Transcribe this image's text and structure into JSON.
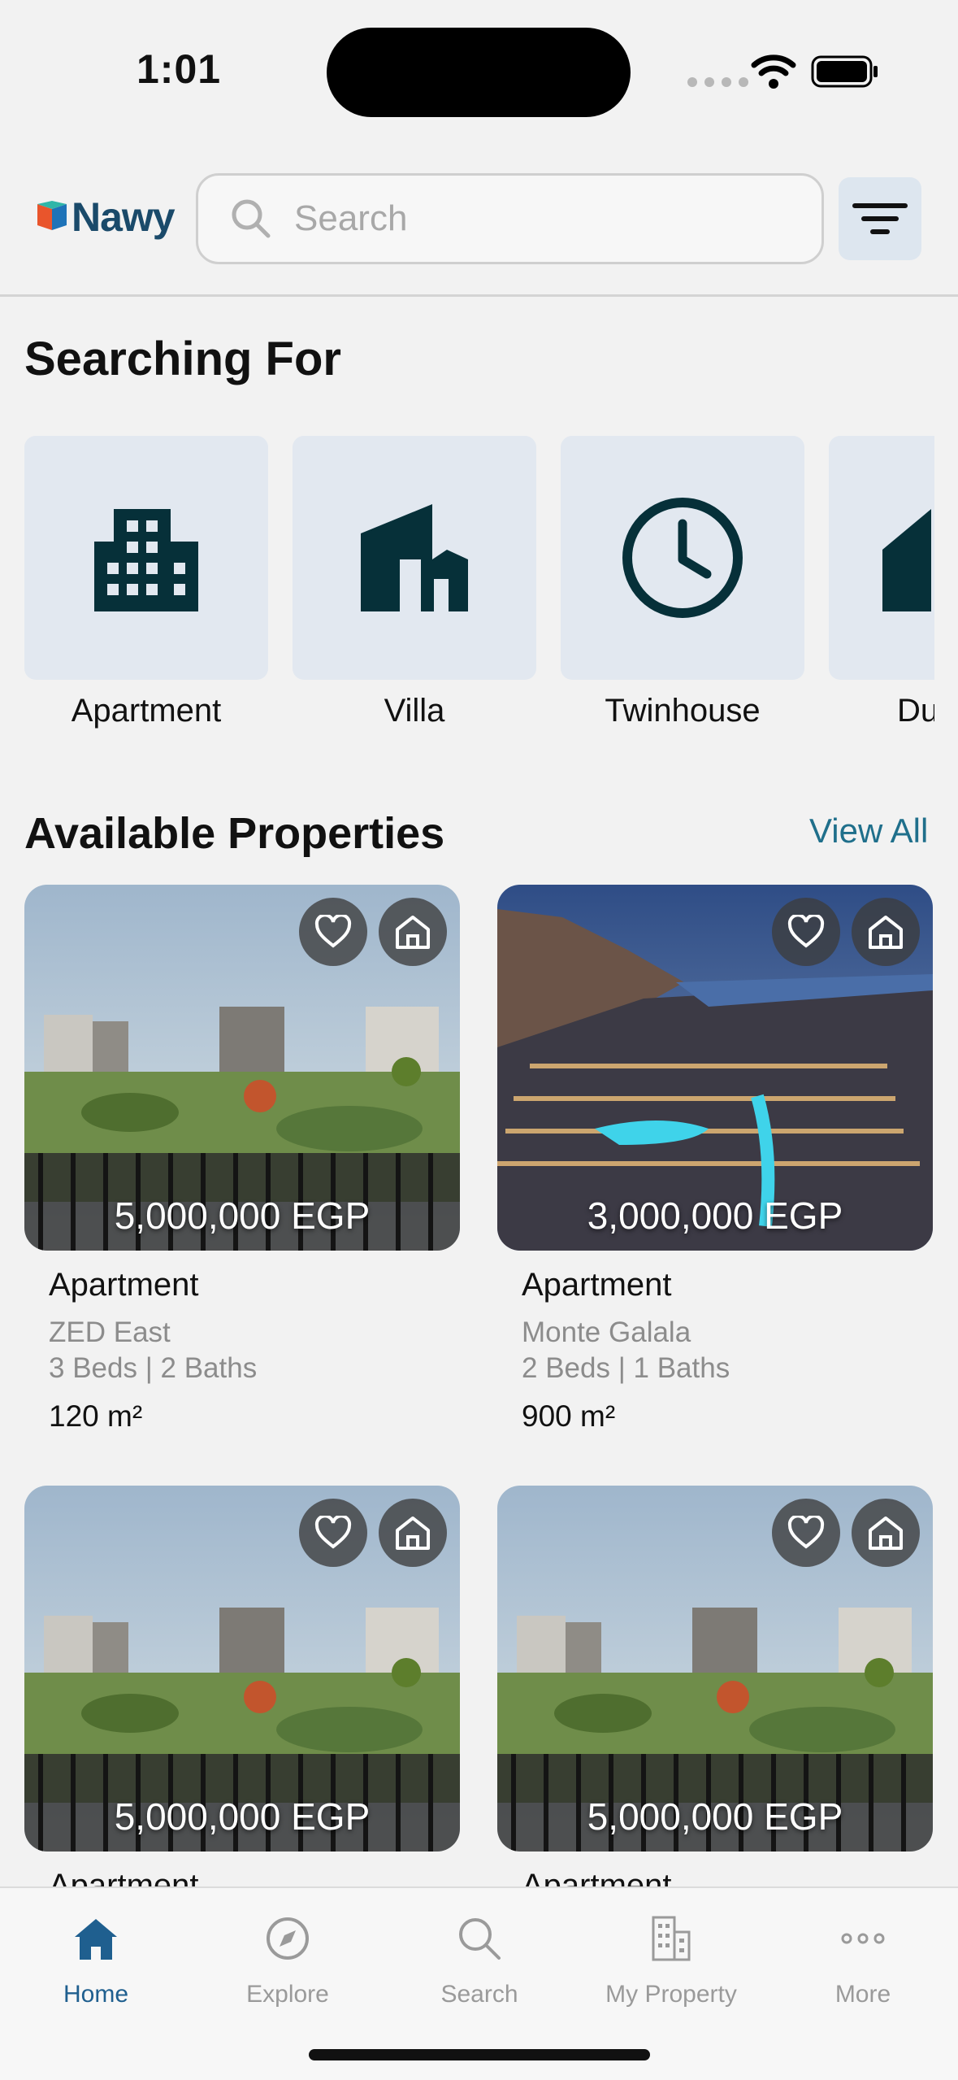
{
  "status_bar": {
    "time": "1:01"
  },
  "header": {
    "logo_text": "Nawy",
    "search_placeholder": "Search",
    "colors": {
      "brand": "#1a4a6a",
      "accent": "#1f6f8b"
    }
  },
  "searching_for": {
    "title": "Searching For",
    "categories": [
      {
        "label": "Apartment",
        "icon": "building-icon"
      },
      {
        "label": "Villa",
        "icon": "villa-icon"
      },
      {
        "label": "Twinhouse",
        "icon": "clock-icon"
      },
      {
        "label": "Du",
        "icon": "house-icon"
      }
    ]
  },
  "available": {
    "title": "Available Properties",
    "view_all": "View All",
    "properties": [
      {
        "price": "5,000,000 EGP",
        "type": "Apartment",
        "location": "ZED East",
        "beds_baths": "3 Beds  | 2 Baths",
        "area": "120 m²"
      },
      {
        "price": "3,000,000 EGP",
        "type": "Apartment",
        "location": "Monte Galala",
        "beds_baths": "2 Beds  | 1 Baths",
        "area": "900 m²"
      },
      {
        "price": "5,000,000 EGP",
        "type": "Apartment"
      },
      {
        "price": "5,000,000 EGP",
        "type": "Apartment"
      }
    ]
  },
  "tabs": [
    {
      "label": "Home",
      "icon": "home-icon",
      "active": true
    },
    {
      "label": "Explore",
      "icon": "compass-icon",
      "active": false
    },
    {
      "label": "Search",
      "icon": "search-icon",
      "active": false
    },
    {
      "label": "My Property",
      "icon": "buildings-icon",
      "active": false
    },
    {
      "label": "More",
      "icon": "more-icon",
      "active": false
    }
  ]
}
